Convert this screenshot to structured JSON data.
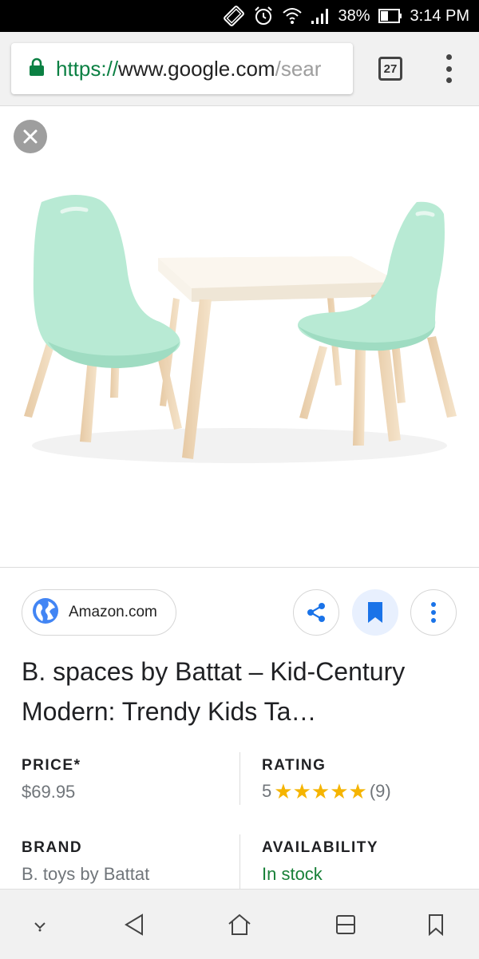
{
  "status_bar": {
    "battery": "38%",
    "time": "3:14 PM",
    "icons": [
      "screen-rotate-icon",
      "alarm-icon",
      "wifi-icon",
      "signal-icon",
      "battery-icon"
    ]
  },
  "browser": {
    "url_scheme": "https://",
    "url_host": "www.google.com",
    "url_path": "/sear",
    "tab_count": "27"
  },
  "source": {
    "name": "Amazon.com"
  },
  "product": {
    "title": "B. spaces by Battat – Kid-Century Modern: Trendy Kids Ta…",
    "price_label": "PRICE*",
    "price": "$69.95",
    "rating_label": "RATING",
    "rating_value": "5",
    "rating_stars": 5,
    "rating_count": "(9)",
    "brand_label": "BRAND",
    "brand": "B. toys by Battat",
    "availability_label": "AVAILABILITY",
    "availability": "In stock"
  },
  "colors": {
    "lock": "#0b8043",
    "star": "#f5b400",
    "in_stock": "#188038",
    "accent": "#1a73e8"
  }
}
